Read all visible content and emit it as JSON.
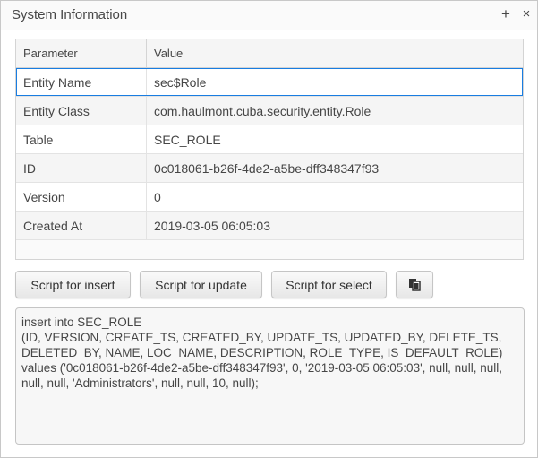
{
  "window": {
    "title": "System Information",
    "maximize_icon": "+",
    "close_icon": "×"
  },
  "table": {
    "columns": {
      "parameter": "Parameter",
      "value": "Value"
    },
    "rows": [
      {
        "parameter": "Entity Name",
        "value": "sec$Role"
      },
      {
        "parameter": "Entity Class",
        "value": "com.haulmont.cuba.security.entity.Role"
      },
      {
        "parameter": "Table",
        "value": "SEC_ROLE"
      },
      {
        "parameter": "ID",
        "value": "0c018061-b26f-4de2-a5be-dff348347f93"
      },
      {
        "parameter": "Version",
        "value": "0"
      },
      {
        "parameter": "Created At",
        "value": "2019-03-05 06:05:03"
      }
    ]
  },
  "buttons": {
    "insert": "Script for insert",
    "update": "Script for update",
    "select": "Script for select",
    "copy_icon": "copy-to-clipboard-icon"
  },
  "script": {
    "text": "insert into SEC_ROLE\n(ID, VERSION, CREATE_TS, CREATED_BY, UPDATE_TS, UPDATED_BY, DELETE_TS, DELETED_BY, NAME, LOC_NAME, DESCRIPTION, ROLE_TYPE, IS_DEFAULT_ROLE)\nvalues ('0c018061-b26f-4de2-a5be-dff348347f93', 0, '2019-03-05 06:05:03', null, null, null, null, null, 'Administrators', null, null, 10, null);"
  },
  "colors": {
    "selection_border": "#197de1",
    "row_alt": "#f5f5f5"
  }
}
